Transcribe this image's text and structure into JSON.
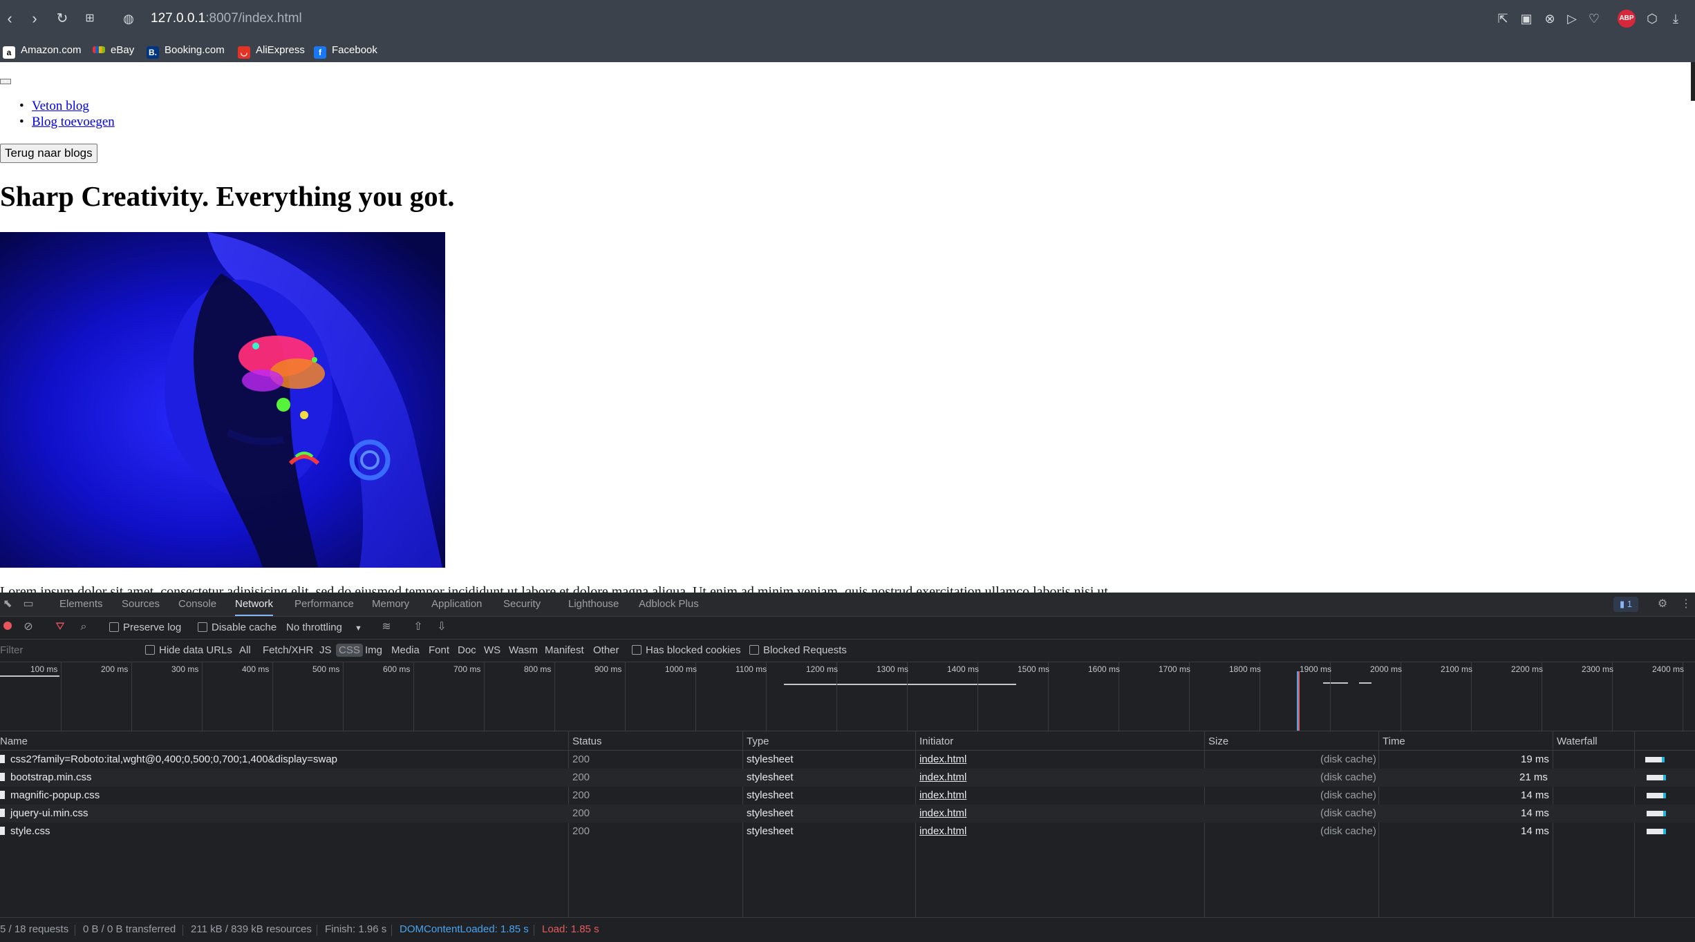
{
  "browser": {
    "url_host": "127.0.0.1",
    "url_rest": ":8007/index.html",
    "bookmarks": [
      {
        "label": "Amazon.com",
        "icon": "amazon-icon"
      },
      {
        "label": "eBay",
        "icon": "ebay-icon"
      },
      {
        "label": "Booking.com",
        "icon": "booking-icon"
      },
      {
        "label": "AliExpress",
        "icon": "aliexpress-icon"
      },
      {
        "label": "Facebook",
        "icon": "facebook-icon"
      }
    ],
    "abp_label": "ABP"
  },
  "page": {
    "nav_links": [
      "Veton blog",
      "Blog toevoegen"
    ],
    "back_button": "Terug naar blogs",
    "title": "Sharp Creativity. Everything you got.",
    "body_text": "Lorem ipsum dolor sit amet, consectetur adipisicing elit, sed do eiusmod tempor incididunt ut labore et dolore magna aliqua. Ut enim ad minim veniam, quis nostrud exercitation ullamco laboris nisi ut"
  },
  "devtools": {
    "tabs": [
      "Elements",
      "Sources",
      "Console",
      "Network",
      "Performance",
      "Memory",
      "Application",
      "Security",
      "Lighthouse",
      "Adblock Plus"
    ],
    "active_tab": "Network",
    "issues_count": "1",
    "preserve_log": "Preserve log",
    "disable_cache": "Disable cache",
    "throttling": "No throttling",
    "filter_placeholder": "Filter",
    "hide_data_urls": "Hide data URLs",
    "filter_types": [
      "All",
      "Fetch/XHR",
      "JS",
      "CSS",
      "Img",
      "Media",
      "Font",
      "Doc",
      "WS",
      "Wasm",
      "Manifest",
      "Other"
    ],
    "active_filter": "CSS",
    "has_blocked_cookies": "Has blocked cookies",
    "blocked_requests": "Blocked Requests",
    "timeline_ticks": [
      "100 ms",
      "200 ms",
      "300 ms",
      "400 ms",
      "500 ms",
      "600 ms",
      "700 ms",
      "800 ms",
      "900 ms",
      "1000 ms",
      "1100 ms",
      "1200 ms",
      "1300 ms",
      "1400 ms",
      "1500 ms",
      "1600 ms",
      "1700 ms",
      "1800 ms",
      "1900 ms",
      "2000 ms",
      "2100 ms",
      "2200 ms",
      "2300 ms",
      "2400 ms"
    ],
    "columns": [
      "Name",
      "Status",
      "Type",
      "Initiator",
      "Size",
      "Time",
      "Waterfall"
    ],
    "rows": [
      {
        "name": "css2?family=Roboto:ital,wght@0,400;0,500;0,700;1,400&display=swap",
        "status": "200",
        "type": "stylesheet",
        "initiator": "index.html",
        "size": "(disk cache)",
        "time": "19 ms"
      },
      {
        "name": "bootstrap.min.css",
        "status": "200",
        "type": "stylesheet",
        "initiator": "index.html",
        "size": "(disk cache)",
        "time": "21 ms"
      },
      {
        "name": "magnific-popup.css",
        "status": "200",
        "type": "stylesheet",
        "initiator": "index.html",
        "size": "(disk cache)",
        "time": "14 ms"
      },
      {
        "name": "jquery-ui.min.css",
        "status": "200",
        "type": "stylesheet",
        "initiator": "index.html",
        "size": "(disk cache)",
        "time": "14 ms"
      },
      {
        "name": "style.css",
        "status": "200",
        "type": "stylesheet",
        "initiator": "index.html",
        "size": "(disk cache)",
        "time": "14 ms"
      }
    ],
    "status_bar": {
      "requests": "5 / 18 requests",
      "transferred": "0 B / 0 B transferred",
      "resources": "211 kB / 839 kB resources",
      "finish": "Finish: 1.96 s",
      "dom_loaded": "DOMContentLoaded: 1.85 s",
      "load": "Load: 1.85 s"
    },
    "colors": {
      "dom_loaded": "#4aa3ee",
      "load": "#e35d5d",
      "accent": "#8ab4f8",
      "record": "#e8555a"
    }
  }
}
